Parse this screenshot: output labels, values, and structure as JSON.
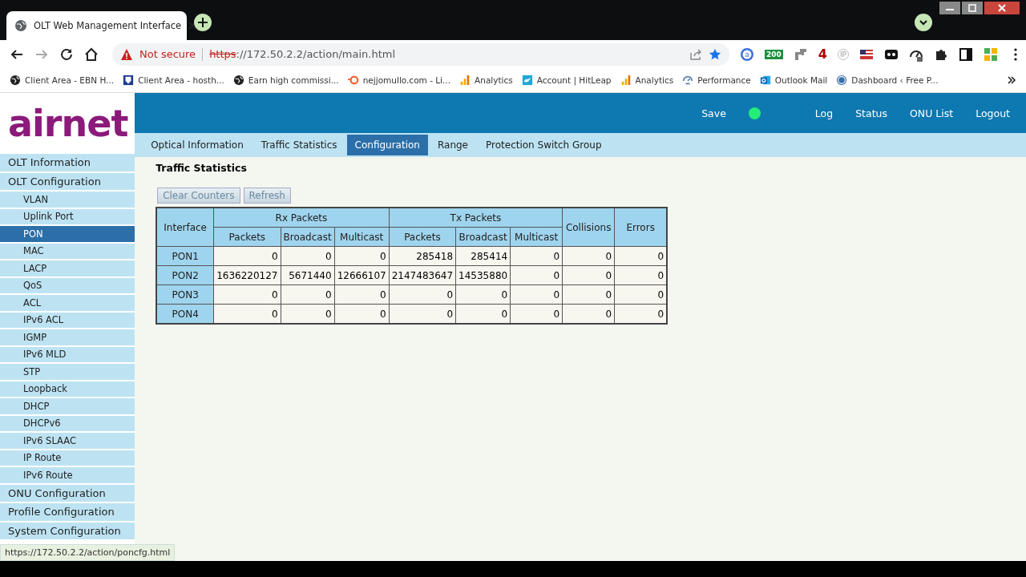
{
  "browser": {
    "tab_title": "OLT Web Management Interface",
    "security": "Not secure",
    "url_scheme": "https",
    "url_rest": "://172.50.2.2/action/main.html",
    "extensions": [
      {
        "kind": "circle-a",
        "text": "a"
      },
      {
        "kind": "badge",
        "text": "200"
      },
      {
        "kind": "steps"
      },
      {
        "kind": "digit",
        "text": "4"
      },
      {
        "kind": "ip",
        "text": "IP"
      },
      {
        "kind": "flag"
      },
      {
        "kind": "mask"
      },
      {
        "kind": "gauge"
      },
      {
        "kind": "puzzle"
      },
      {
        "kind": "panel"
      },
      {
        "kind": "grid"
      }
    ],
    "bookmarks": [
      {
        "kind": "globe",
        "label": "Client Area - EBN H..."
      },
      {
        "kind": "shield",
        "label": "Client Area - hosth..."
      },
      {
        "kind": "globe",
        "label": "Earn high commissi..."
      },
      {
        "kind": "swirl",
        "label": "nejjomullo.com - Li..."
      },
      {
        "kind": "bars",
        "label": "Analytics"
      },
      {
        "kind": "bird",
        "label": "Account | HitLeap"
      },
      {
        "kind": "bars",
        "label": "Analytics"
      },
      {
        "kind": "speed",
        "label": "Performance"
      },
      {
        "kind": "outlook",
        "label": "Outlook Mail"
      },
      {
        "kind": "wp",
        "label": "Dashboard ‹ Free P..."
      }
    ],
    "status_url": "https://172.50.2.2/action/poncfg.html"
  },
  "logo": "airnet",
  "header_links": [
    {
      "kind": "save",
      "label": "Save"
    },
    {
      "kind": "dot",
      "color": "#22ee77"
    },
    {
      "kind": "link",
      "label": "Log"
    },
    {
      "kind": "link",
      "label": "Status"
    },
    {
      "kind": "link",
      "label": "ONU List"
    },
    {
      "kind": "link",
      "label": "Logout"
    }
  ],
  "sidebar": [
    {
      "label": "OLT Information",
      "selected": false
    },
    {
      "label": "OLT Configuration",
      "selected": false,
      "children": [
        {
          "label": "VLAN",
          "selected": false
        },
        {
          "label": "Uplink Port",
          "selected": false
        },
        {
          "label": "PON",
          "selected": true
        },
        {
          "label": "MAC",
          "selected": false
        },
        {
          "label": "LACP",
          "selected": false
        },
        {
          "label": "QoS",
          "selected": false
        },
        {
          "label": "ACL",
          "selected": false
        },
        {
          "label": "IPv6 ACL",
          "selected": false
        },
        {
          "label": "IGMP",
          "selected": false
        },
        {
          "label": "IPv6 MLD",
          "selected": false
        },
        {
          "label": "STP",
          "selected": false
        },
        {
          "label": "Loopback",
          "selected": false
        },
        {
          "label": "DHCP",
          "selected": false
        },
        {
          "label": "DHCPv6",
          "selected": false
        },
        {
          "label": "IPv6 SLAAC",
          "selected": false
        },
        {
          "label": "IP Route",
          "selected": false
        },
        {
          "label": "IPv6 Route",
          "selected": false
        }
      ]
    },
    {
      "label": "ONU Configuration",
      "selected": false
    },
    {
      "label": "Profile Configuration",
      "selected": false
    },
    {
      "label": "System Configuration",
      "selected": false
    }
  ],
  "tabs": [
    {
      "label": "Optical Information",
      "selected": false
    },
    {
      "label": "Traffic Statistics",
      "selected": false
    },
    {
      "label": "Configuration",
      "selected": true
    },
    {
      "label": "Range",
      "selected": false
    },
    {
      "label": "Protection Switch Group",
      "selected": false
    }
  ],
  "section_title": "Traffic Statistics",
  "buttons": [
    "Clear Counters",
    "Refresh"
  ],
  "table": {
    "interface_header": "Interface",
    "groups": [
      "Rx Packets",
      "Tx Packets"
    ],
    "sub_columns": [
      "Packets",
      "Broadcast",
      "Multicast",
      "Packets",
      "Broadcast",
      "Multicast"
    ],
    "tail_columns": [
      "Collisions",
      "Errors"
    ],
    "rows": [
      {
        "interface": "PON1",
        "values": [
          "0",
          "0",
          "0",
          "285418",
          "285414",
          "0",
          "0",
          "0"
        ]
      },
      {
        "interface": "PON2",
        "values": [
          "1636220127",
          "5671440",
          "12666107",
          "2147483647",
          "14535880",
          "0",
          "0",
          "0"
        ]
      },
      {
        "interface": "PON3",
        "values": [
          "0",
          "0",
          "0",
          "0",
          "0",
          "0",
          "0",
          "0"
        ]
      },
      {
        "interface": "PON4",
        "values": [
          "0",
          "0",
          "0",
          "0",
          "0",
          "0",
          "0",
          "0"
        ]
      }
    ]
  }
}
